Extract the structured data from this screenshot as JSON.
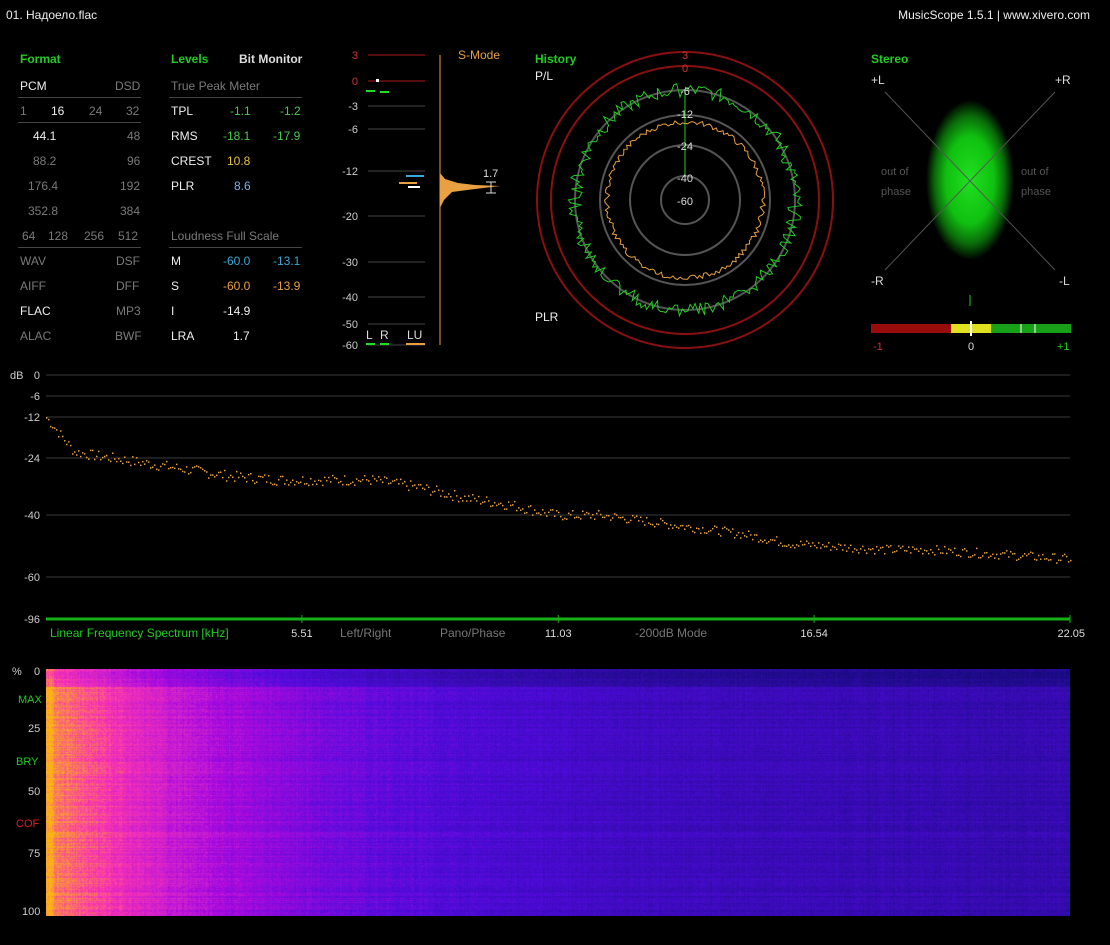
{
  "window": {
    "file_title": "01. Надоело.flac",
    "app_title": "MusicScope 1.5.1 | www.xivero.com"
  },
  "format": {
    "header": "Format",
    "pcm": "PCM",
    "dsd": "DSD",
    "bits": [
      "1",
      "16",
      "24",
      "32"
    ],
    "rates": [
      {
        "left": "44.1",
        "right": "48"
      },
      {
        "left": "88.2",
        "right": "96"
      },
      {
        "left": "176.4",
        "right": "192"
      },
      {
        "left": "352.8",
        "right": "384"
      }
    ],
    "dsd_rates": [
      "64",
      "128",
      "256",
      "512"
    ],
    "containers": [
      {
        "left": "WAV",
        "right": "DSF"
      },
      {
        "left": "AIFF",
        "right": "DFF"
      },
      {
        "left": "FLAC",
        "right": "MP3"
      },
      {
        "left": "ALAC",
        "right": "BWF"
      }
    ]
  },
  "levels": {
    "header": "Levels",
    "bit_monitor": "Bit Monitor",
    "true_peak_label": "True Peak Meter",
    "rows": [
      {
        "label": "TPL",
        "l": "-1.1",
        "r": "-1.2"
      },
      {
        "label": "RMS",
        "l": "-18.1",
        "r": "-17.9"
      },
      {
        "label": "CREST",
        "l": "10.8",
        "r": ""
      },
      {
        "label": "PLR",
        "l": "8.6",
        "r": ""
      }
    ],
    "loudness_label": "Loudness Full Scale",
    "loudness": [
      {
        "label": "M",
        "a": "-60.0",
        "b": "-13.1"
      },
      {
        "label": "S",
        "a": "-60.0",
        "b": "-13.9"
      },
      {
        "label": "I",
        "a": "-14.9",
        "b": ""
      },
      {
        "label": "LRA",
        "a": "1.7",
        "b": ""
      }
    ],
    "colors": {
      "green": "#4ac94a",
      "cyan": "#3aa7d8",
      "orange": "#e8a040",
      "yellow": "#e6c040"
    }
  },
  "meter": {
    "mode": "S-Mode",
    "scale": [
      "3",
      "0",
      "-3",
      "-6",
      "-12",
      "-20",
      "-30",
      "-40",
      "-50",
      "-60"
    ],
    "bottom_labels": [
      "L",
      "R",
      "LU"
    ],
    "lu_value": "1.7"
  },
  "history": {
    "header": "History",
    "pl_label": "P/L",
    "plr_label": "PLR",
    "ring_labels": [
      "3",
      "0",
      "-6",
      "-12",
      "-24",
      "-40",
      "-60"
    ]
  },
  "stereo": {
    "header": "Stereo",
    "plus_l": "+L",
    "plus_r": "+R",
    "minus_r": "-R",
    "minus_l": "-L",
    "out_of_phase": "out of",
    "phase": "phase",
    "corr_min": "-1",
    "corr_mid": "0",
    "corr_max": "+1"
  },
  "spectrum": {
    "db_label": "dB",
    "db_ticks": [
      "0",
      "-6",
      "-12",
      "-24",
      "-40",
      "-60",
      "-96"
    ],
    "title": "Linear Frequency Spectrum [kHz]",
    "freq_ticks": [
      "5.51",
      "11.03",
      "16.54",
      "22.05"
    ],
    "modes": [
      "Left/Right",
      "Pano/Phase",
      "-200dB Mode"
    ]
  },
  "spectrogram": {
    "pct_label": "%",
    "ticks": [
      "0",
      "25",
      "50",
      "75",
      "100"
    ],
    "markers": [
      {
        "label": "MAX",
        "color": "#22cc22"
      },
      {
        "label": "BRY",
        "color": "#22cc22"
      },
      {
        "label": "COF",
        "color": "#e02020"
      }
    ]
  },
  "chart_data": [
    {
      "type": "line",
      "title": "",
      "xlabel": "Linear Frequency Spectrum [kHz]",
      "ylabel": "dB",
      "xlim": [
        0,
        22.05
      ],
      "ylim": [
        -96,
        0
      ],
      "x": [
        0,
        0.3,
        0.6,
        1,
        1.5,
        2,
        3,
        4,
        5,
        6,
        7,
        8,
        9,
        10,
        11,
        12,
        13,
        14,
        15,
        16,
        17,
        18,
        19,
        20,
        21,
        22
      ],
      "series": [
        {
          "values": [
            -12,
            -17,
            -22,
            -23,
            -24,
            -25,
            -27,
            -29,
            -30,
            -30,
            -30,
            -32,
            -35,
            -37,
            -40,
            -40,
            -42,
            -44,
            -46,
            -49,
            -50,
            -51,
            -51,
            -52,
            -53,
            -54
          ]
        }
      ]
    }
  ]
}
